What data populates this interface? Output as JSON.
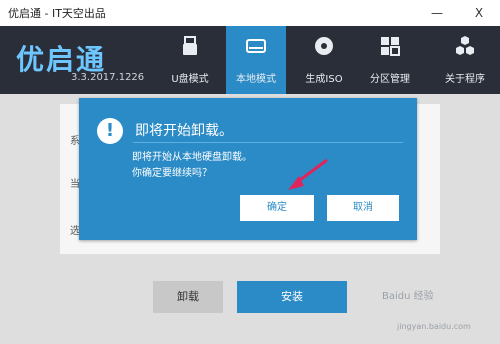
{
  "window": {
    "title": "优启通 - IT天空出品",
    "minimize_glyph": "—",
    "close_glyph": "X"
  },
  "header": {
    "logo": "优启通",
    "version": "3.3.2017.1226",
    "tabs": [
      {
        "label": "U盘模式",
        "icon": "usb-drive-icon",
        "active": false
      },
      {
        "label": "本地模式",
        "icon": "hard-disk-icon",
        "active": true
      },
      {
        "label": "生成ISO",
        "icon": "disc-icon",
        "active": false
      },
      {
        "label": "分区管理",
        "icon": "grid-icon",
        "active": false
      },
      {
        "label": "关于程序",
        "icon": "hexagons-icon",
        "active": false
      }
    ]
  },
  "main": {
    "ghost_labels": [
      "系",
      "当",
      "选"
    ],
    "uninstall_label": "卸载",
    "install_label": "安装"
  },
  "dialog": {
    "icon": "exclamation-icon",
    "title": "即将开始卸载。",
    "message_line1": "即将开始从本地硬盘卸载。",
    "message_line2": "你确定要继续吗？",
    "ok_label": "确定",
    "cancel_label": "取消"
  },
  "watermark": {
    "text": "Baidu 经验",
    "url": "jingyan.baidu.com"
  },
  "colors": {
    "accent": "#2b8bc6",
    "header_bg": "#2a2e38",
    "annotation_arrow": "#e0245e"
  }
}
